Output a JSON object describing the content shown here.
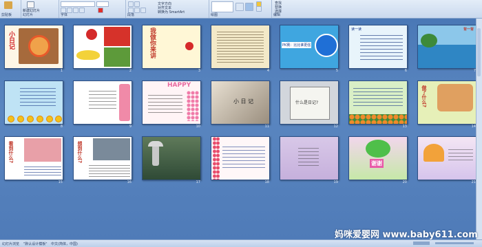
{
  "ribbon": {
    "groups": [
      {
        "id": "clipboard",
        "label": "剪贴板"
      },
      {
        "id": "slides",
        "label": "幻灯片"
      },
      {
        "id": "font",
        "label": "字体"
      },
      {
        "id": "paragraph",
        "label": "段落"
      },
      {
        "id": "drawing",
        "label": "绘图"
      },
      {
        "id": "editing",
        "label": "编辑"
      }
    ],
    "new_slide_label": "新建幻灯片",
    "text_direction_label": "文字方向",
    "align_text_label": "对齐文本",
    "smartart_label": "转换为 SmartArt",
    "find_label": "查找",
    "replace_label": "替换",
    "select_label": "选择"
  },
  "slides": [
    {
      "n": "1",
      "title": "小日记"
    },
    {
      "n": "2",
      "title": ""
    },
    {
      "n": "3",
      "title": "我做你来讲"
    },
    {
      "n": "4",
      "title": ""
    },
    {
      "n": "5",
      "title": "PK赛：比比谁更强"
    },
    {
      "n": "6",
      "title": "读一读"
    },
    {
      "n": "7",
      "title": "背一背"
    },
    {
      "n": "8",
      "title": ""
    },
    {
      "n": "9",
      "title": ""
    },
    {
      "n": "10",
      "title": "HAPPY"
    },
    {
      "n": "11",
      "title": "小 日 记"
    },
    {
      "n": "12",
      "title": "什么是日记?"
    },
    {
      "n": "13",
      "title": ""
    },
    {
      "n": "14",
      "title": "做了什么?"
    },
    {
      "n": "15",
      "title": "看到什么?"
    },
    {
      "n": "16",
      "title": "想到什么?"
    },
    {
      "n": "17",
      "title": ""
    },
    {
      "n": "18",
      "title": ""
    },
    {
      "n": "19",
      "title": ""
    },
    {
      "n": "20",
      "title": "谢谢"
    },
    {
      "n": "21",
      "title": ""
    }
  ],
  "status": {
    "left": "幻灯片浏览",
    "theme": "\"默认设计模板\"",
    "lang": "中文(简体，中国)"
  },
  "watermark": "妈咪爱婴网 www.baby611.com",
  "colors": {
    "sorter_bg": "#4a78b6",
    "ribbon_bg": "#dbe6f4"
  }
}
